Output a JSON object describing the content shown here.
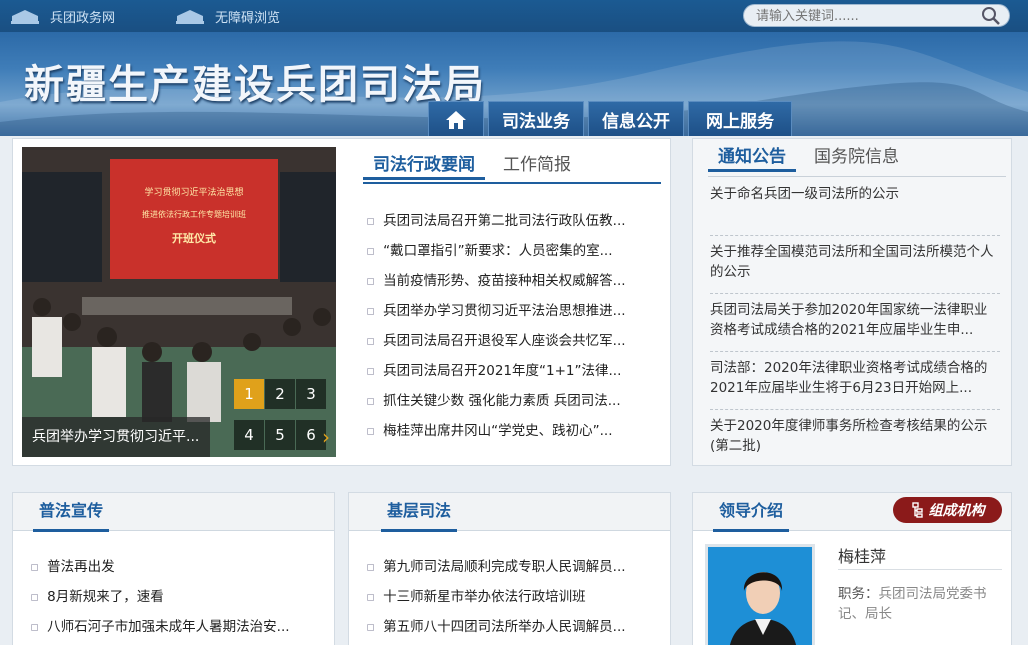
{
  "topbar": {
    "links": [
      "兵团政务网",
      "无障碍浏览"
    ],
    "search_placeholder": "请输入关键词......"
  },
  "header": {
    "site_title": "新疆生产建设兵团司法局",
    "nav": [
      "司法业务",
      "信息公开",
      "网上服务"
    ]
  },
  "slideshow": {
    "banner_line1": "学习贯彻习近平法治思想",
    "banner_line2": "推进依法行政工作专题培训班",
    "banner_line3": "开班仪式",
    "caption": "兵团举办学习贯彻习近平...",
    "pages": [
      "1",
      "2",
      "3",
      "4",
      "5",
      "6"
    ],
    "active_page": 1
  },
  "news": {
    "tabs": [
      "司法行政要闻",
      "工作简报"
    ],
    "items": [
      "兵团司法局召开第二批司法行政队伍教...",
      "“戴口罩指引”新要求：人员密集的室...",
      "当前疫情形势、疫苗接种相关权威解答...",
      "兵团举办学习贯彻习近平法治思想推进...",
      "兵团司法局召开退役军人座谈会共忆军...",
      "兵团司法局召开2021年度“1+1”法律...",
      "抓住关键少数 强化能力素质 兵团司法...",
      "梅桂萍出席井冈山“学党史、践初心”..."
    ]
  },
  "notices": {
    "tabs": [
      "通知公告",
      "国务院信息"
    ],
    "items": [
      "关于命名兵团一级司法所的公示",
      "关于推荐全国模范司法所和全国司法所模范个人的公示",
      "兵团司法局关于参加2020年国家统一法律职业资格考试成绩合格的2021年应届毕业生申...",
      "司法部：2020年法律职业资格考试成绩合格的2021年应届毕业生将于6月23日开始网上...",
      "关于2020年度律师事务所检查考核结果的公示(第二批)"
    ]
  },
  "pufa": {
    "title": "普法宣传",
    "items": [
      "普法再出发",
      "8月新规来了，速看",
      "八师石河子市加强未成年人暑期法治安..."
    ]
  },
  "jiceng": {
    "title": "基层司法",
    "items": [
      "第九师司法局顺利完成专职人民调解员...",
      "十三师新星市举办依法行政培训班",
      "第五师八十四团司法所举办人民调解员..."
    ]
  },
  "leader": {
    "title": "领导介绍",
    "org_button": "组成机构",
    "name": "梅桂萍",
    "duty_label": "职务：",
    "duty_value": "兵团司法局党委书记、局长"
  },
  "colors": {
    "accent": "#1e5e9e",
    "nav": "#1d4f86",
    "active_pager": "#e0a11b",
    "org_button": "#8b1a1a"
  }
}
